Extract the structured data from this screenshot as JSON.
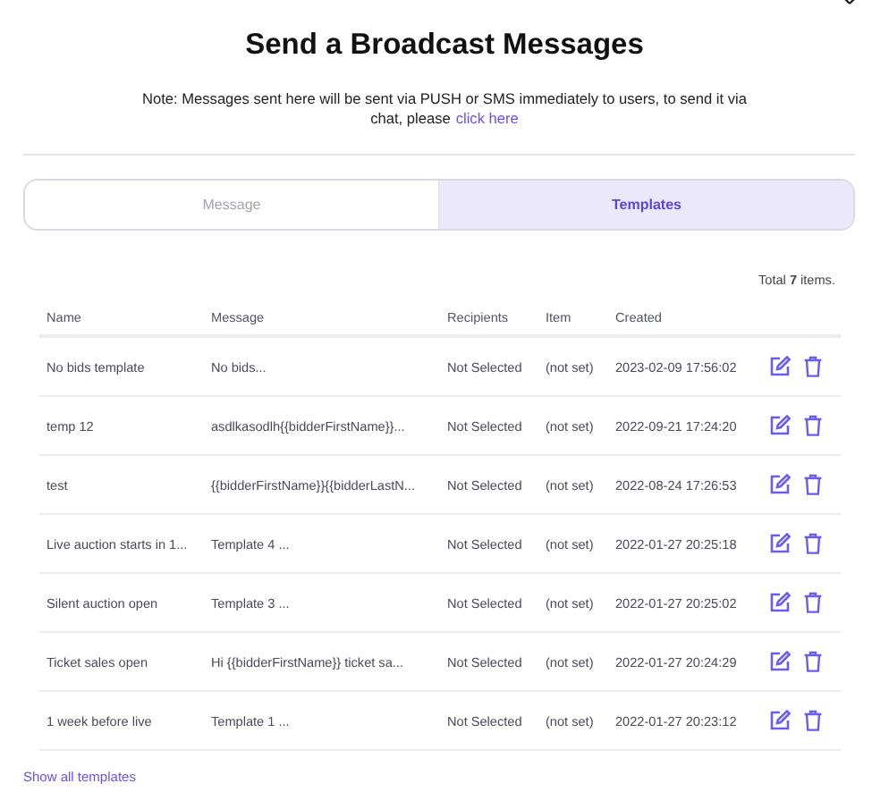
{
  "dialog": {
    "title": "Send a Broadcast Messages",
    "note": "Note: Messages sent here will be sent via PUSH or SMS immediately to users, to send it via chat, please",
    "note_link": "click here"
  },
  "tabs": [
    {
      "label": "Message",
      "selected": false
    },
    {
      "label": "Templates",
      "selected": true
    }
  ],
  "total": "Total **7** items.",
  "table": {
    "columns": [
      "Name",
      "Message",
      "Recipients",
      "Item",
      "Created"
    ],
    "rows": [
      {
        "cells": [
          "No bids template",
          "No bids...",
          "Not Selected",
          "(not set)",
          "2023-02-09 17:56:02"
        ]
      },
      {
        "cells": [
          "temp 12",
          "asdlkasodlh{{bidderFirstName}}...",
          "Not Selected",
          "(not set)",
          "2022-09-21 17:24:20"
        ]
      },
      {
        "cells": [
          "test",
          "{{bidderFirstName}}{{bidderLastN...",
          "Not Selected",
          "(not set)",
          "2022-08-24 17:26:53"
        ]
      },
      {
        "cells": [
          "Live auction starts in 1...",
          "Template 4 ...",
          "Not Selected",
          "(not set)",
          "2022-01-27 20:25:18"
        ]
      },
      {
        "cells": [
          "Silent auction open",
          "Template 3 ...",
          "Not Selected",
          "(not set)",
          "2022-01-27 20:25:02"
        ]
      },
      {
        "cells": [
          "Ticket sales open",
          "Hi {{bidderFirstName}} ticket sa...",
          "Not Selected",
          "(not set)",
          "2022-01-27 20:24:29"
        ]
      },
      {
        "cells": [
          "1 week before live",
          "Template 1 ...",
          "Not Selected",
          "(not set)",
          "2022-01-27 20:23:12"
        ]
      }
    ]
  },
  "footer_link": "Show all templates"
}
